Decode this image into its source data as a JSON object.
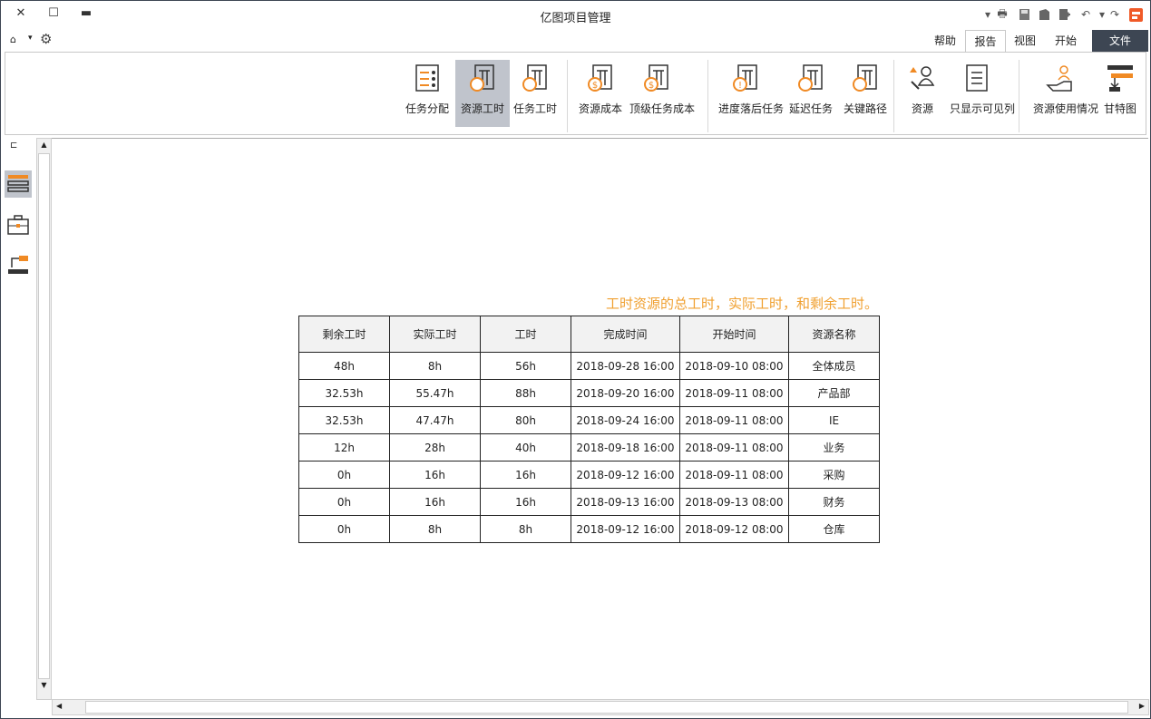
{
  "window": {
    "title": "亿图项目管理"
  },
  "tabs": [
    {
      "label": "文件"
    },
    {
      "label": "开始"
    },
    {
      "label": "视图"
    },
    {
      "label": "报告"
    },
    {
      "label": "帮助"
    }
  ],
  "active_tab": "报告",
  "ribbon": {
    "buttons": [
      {
        "label": "甘特图",
        "icon": "gantt-chart-icon"
      },
      {
        "label": "资源使用情况",
        "icon": "resource-usage-icon"
      },
      {
        "label": "只显示可见列",
        "icon": "visible-columns-icon"
      },
      {
        "label": "资源",
        "icon": "resource-icon"
      },
      {
        "label": "关键路径",
        "icon": "critical-path-icon"
      },
      {
        "label": "延迟任务",
        "icon": "delayed-task-icon"
      },
      {
        "label": "进度落后任务",
        "icon": "behind-schedule-icon"
      },
      {
        "label": "顶级任务成本",
        "icon": "top-task-cost-icon"
      },
      {
        "label": "资源成本",
        "icon": "resource-cost-icon"
      },
      {
        "label": "任务工时",
        "icon": "task-hours-icon"
      },
      {
        "label": "资源工时",
        "icon": "resource-hours-icon",
        "selected": true
      },
      {
        "label": "任务分配",
        "icon": "task-assignment-icon"
      }
    ]
  },
  "report": {
    "caption": "工时资源的总工时，实际工时，和剩余工时。",
    "columns": [
      "资源名称",
      "开始时间",
      "完成时间",
      "工时",
      "实际工时",
      "剩余工时"
    ],
    "rows": [
      [
        "全体成员",
        "2018-09-10 08:00",
        "2018-09-28 16:00",
        "56h",
        "8h",
        "48h"
      ],
      [
        "产品部",
        "2018-09-11 08:00",
        "2018-09-20 16:00",
        "88h",
        "55.47h",
        "32.53h"
      ],
      [
        "IE",
        "2018-09-11 08:00",
        "2018-09-24 16:00",
        "80h",
        "47.47h",
        "32.53h"
      ],
      [
        "业务",
        "2018-09-11 08:00",
        "2018-09-18 16:00",
        "40h",
        "28h",
        "12h"
      ],
      [
        "采购",
        "2018-09-11 08:00",
        "2018-09-12 16:00",
        "16h",
        "16h",
        "0h"
      ],
      [
        "财务",
        "2018-09-13 08:00",
        "2018-09-13 16:00",
        "16h",
        "16h",
        "0h"
      ],
      [
        "仓库",
        "2018-09-12 08:00",
        "2018-09-12 16:00",
        "8h",
        "8h",
        "0h"
      ]
    ]
  },
  "colors": {
    "accent": "#f08a24",
    "file_tab": "#3d4653",
    "selected_button": "#c0c4cc",
    "caption": "#f0a030"
  }
}
